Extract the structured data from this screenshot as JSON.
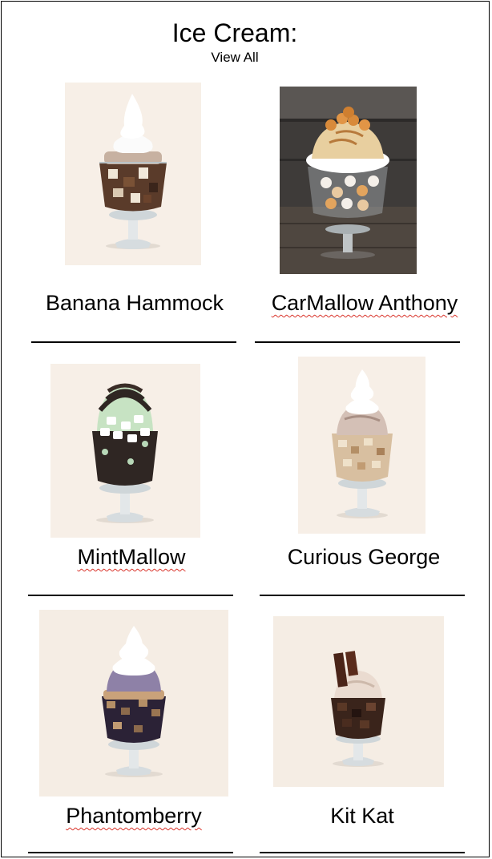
{
  "header": {
    "title": "Ice Cream:",
    "view_all": "View All"
  },
  "items": [
    {
      "name": "Banana Hammock",
      "image": "banana-hammock-sundae"
    },
    {
      "name": "CarMallow Anthony",
      "image": "carmallow-anthony-sundae"
    },
    {
      "name": "MintMallow",
      "image": "mintmallow-sundae"
    },
    {
      "name": "Curious George",
      "image": "curious-george-sundae"
    },
    {
      "name": "Phantomberry",
      "image": "phantomberry-sundae"
    },
    {
      "name": "Kit Kat",
      "image": "kit-kat-sundae"
    }
  ],
  "colors": {
    "spellcheck_underline": "#d9342b",
    "photo_background_light": "#f6efe6",
    "photo_background_dark": "#4a4744"
  }
}
